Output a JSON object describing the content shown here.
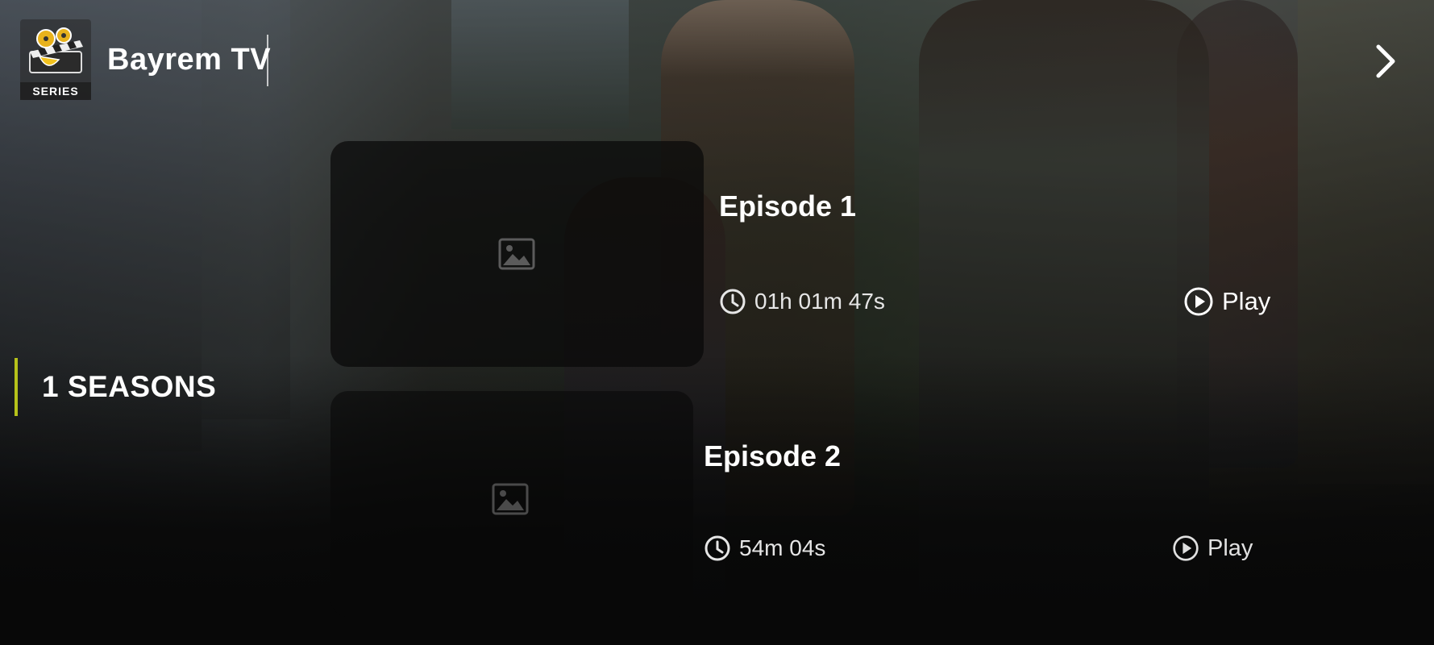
{
  "header": {
    "app_title": "Bayrem TV",
    "logo_label": "SERIES",
    "logo_icon": "film-reel-clapper-icon",
    "next_icon": "chevron-right-icon"
  },
  "seasons": {
    "items": [
      {
        "label": "1 SEASONS",
        "selected": true
      }
    ],
    "accent_color": "#b6c21a"
  },
  "episodes": [
    {
      "title": "Episode 1",
      "duration": "01h 01m 47s",
      "play_label": "Play",
      "thumbnail_icon": "image-placeholder-icon"
    },
    {
      "title": "Episode 2",
      "duration": "54m 04s",
      "play_label": "Play",
      "thumbnail_icon": "image-placeholder-icon"
    }
  ]
}
